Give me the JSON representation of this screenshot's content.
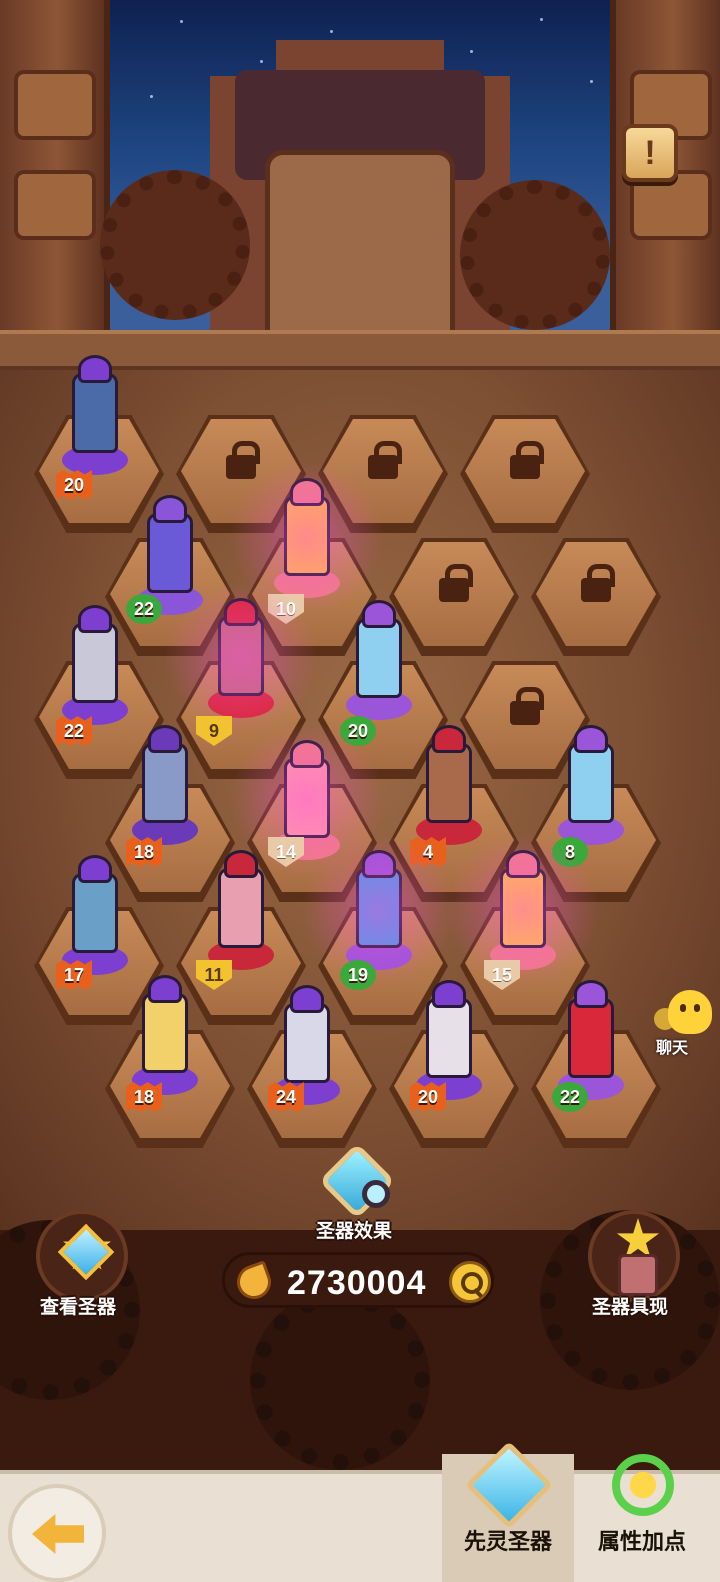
{
  "header": {
    "info_button_icon": "scroll-exclamation-icon",
    "info_symbol": "!"
  },
  "relics": [
    {
      "level": "20",
      "badge": "orange",
      "color": "#7d3fd0",
      "accent": "#4a6aa8"
    },
    {
      "level": "22",
      "badge": "green",
      "color": "#8a55d8",
      "accent": "#6a5ad8"
    },
    {
      "level": "10",
      "badge": "pale",
      "color": "#f07a8a",
      "accent": "#ffb84a"
    },
    {
      "level": "22",
      "badge": "orange",
      "color": "#7d3fd0",
      "accent": "#c8c8d8"
    },
    {
      "level": "9",
      "badge": "gold",
      "color": "#d8283a",
      "accent": "#c06a7a"
    },
    {
      "level": "20",
      "badge": "green",
      "color": "#9a55d8",
      "accent": "#8fd0f0"
    },
    {
      "level": "18",
      "badge": "orange",
      "color": "#6a3ab8",
      "accent": "#8a9ac8"
    },
    {
      "level": "14",
      "badge": "pale",
      "color": "#f07a8a",
      "accent": "#ff9aa8"
    },
    {
      "level": "4",
      "badge": "orange",
      "color": "#c8283a",
      "accent": "#a86a4a"
    },
    {
      "level": "8",
      "badge": "green",
      "color": "#9a55d8",
      "accent": "#8fd0f0"
    },
    {
      "level": "17",
      "badge": "orange",
      "color": "#7d3fd0",
      "accent": "#6aa0c8"
    },
    {
      "level": "11",
      "badge": "gold",
      "color": "#c8283a",
      "accent": "#e8a0b0"
    },
    {
      "level": "19",
      "badge": "green",
      "color": "#9a55d8",
      "accent": "#4a9ae8"
    },
    {
      "level": "15",
      "badge": "pale",
      "color": "#f07a8a",
      "accent": "#ffc04a"
    },
    {
      "level": "18",
      "badge": "orange",
      "color": "#7d3fd0",
      "accent": "#f2d06a"
    },
    {
      "level": "24",
      "badge": "orange",
      "color": "#7d3fd0",
      "accent": "#d8d8e8"
    },
    {
      "level": "20",
      "badge": "orange",
      "color": "#7d3fd0",
      "accent": "#e8e0e8"
    },
    {
      "level": "22",
      "badge": "green",
      "color": "#9a55d8",
      "accent": "#d8283a"
    }
  ],
  "locked_slots": 6,
  "controls": {
    "view_relics": "查看圣器",
    "relic_effect": "圣器效果",
    "relic_manifest": "圣器具现",
    "chat": "聊天"
  },
  "currency": {
    "icon": "arm-strength-icon",
    "amount": "2730004",
    "search_icon": "magnifier-icon"
  },
  "nav": {
    "back_icon": "back-arrow-icon",
    "tabs": [
      {
        "label": "先灵圣器",
        "icon": "relic-gem-icon",
        "active": true
      },
      {
        "label": "属性加点",
        "icon": "attribute-ring-icon",
        "active": false
      }
    ]
  },
  "colors": {
    "level_orange": "#e8601c",
    "level_green": "#3aa83a",
    "level_gold": "#f2c230",
    "board": "#9c6a46",
    "nav_bg": "#e9e0d3"
  }
}
